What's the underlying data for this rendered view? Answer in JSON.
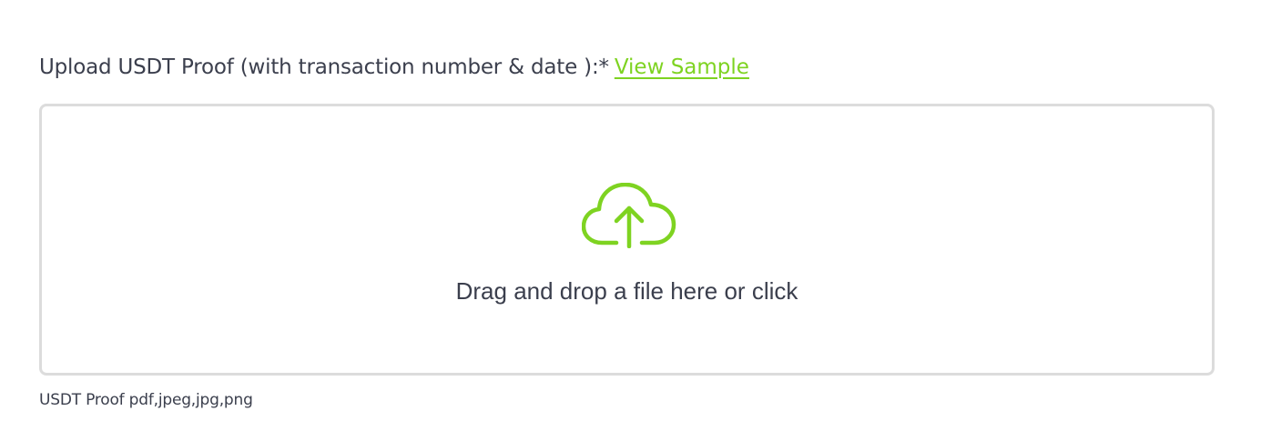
{
  "upload": {
    "label": "Upload USDT Proof (with transaction number & date ):*",
    "view_sample_link": "View Sample",
    "dropzone_text": "Drag and drop a file here or click",
    "hint": "USDT Proof pdf,jpeg,jpg,png"
  },
  "colors": {
    "accent": "#7ed321",
    "text": "#3b3f4d",
    "border": "#dcdcdc"
  },
  "icons": {
    "dropzone": "cloud-upload-icon"
  }
}
